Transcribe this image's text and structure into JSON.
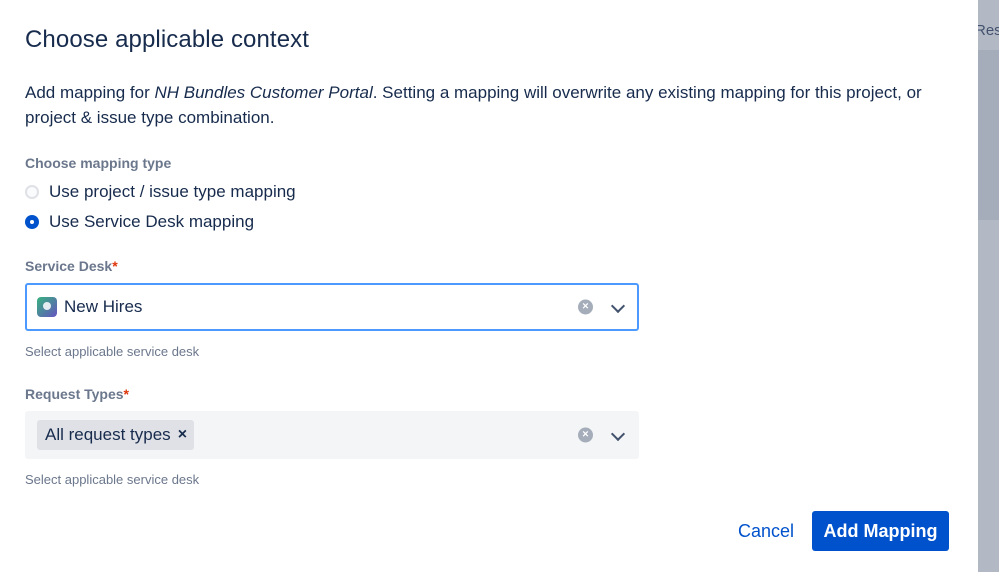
{
  "background": {
    "partial_text": "Res"
  },
  "dialog": {
    "title": "Choose applicable context",
    "description": {
      "prefix": "Add mapping for ",
      "project_name": "NH Bundles Customer Portal",
      "suffix": ". Setting a mapping will overwrite any existing mapping for this project, or project & issue type combination."
    },
    "mapping_type": {
      "label": "Choose mapping type",
      "options": [
        {
          "label": "Use project / issue type mapping",
          "checked": false
        },
        {
          "label": "Use Service Desk mapping",
          "checked": true
        }
      ]
    },
    "service_desk": {
      "label": "Service Desk",
      "required_mark": "*",
      "value": "New Hires",
      "icon": "service-desk-avatar-icon",
      "clear_symbol": "×",
      "helper": "Select applicable service desk"
    },
    "request_types": {
      "label": "Request Types",
      "required_mark": "*",
      "chips": [
        {
          "label": "All request types",
          "remove_symbol": "×"
        }
      ],
      "clear_symbol": "×",
      "helper": "Select applicable service desk"
    },
    "actions": {
      "cancel_label": "Cancel",
      "submit_label": "Add Mapping"
    },
    "colors": {
      "primary": "#0052cc",
      "text": "#172b4d",
      "subtle": "#6b778c",
      "required": "#de350b",
      "focus": "#4c9aff"
    }
  }
}
